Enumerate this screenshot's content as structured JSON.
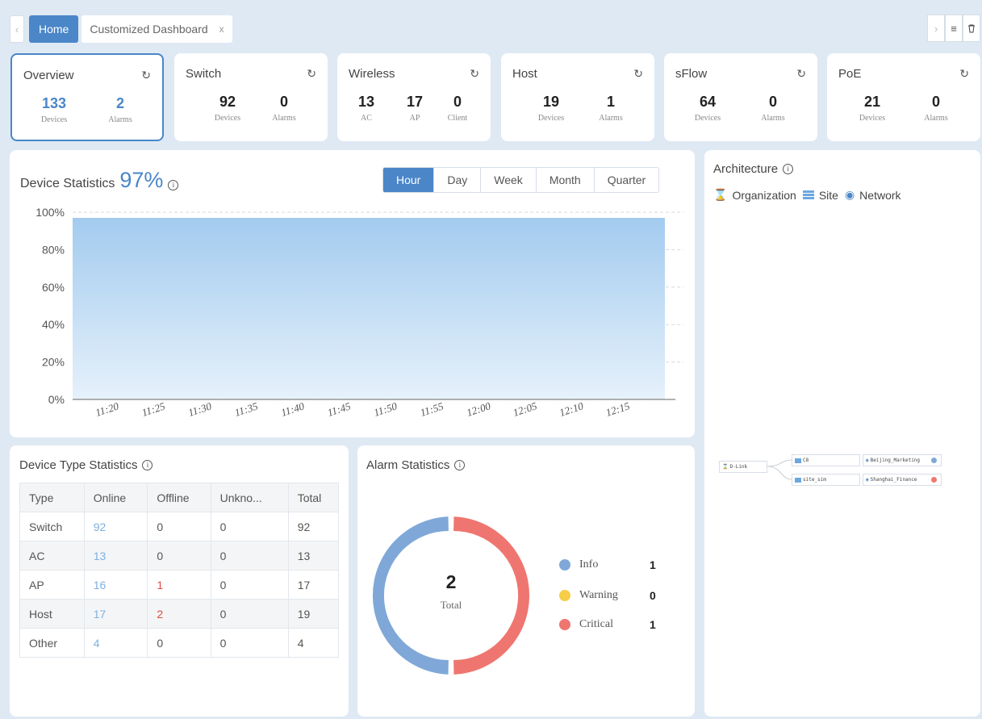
{
  "tabs": {
    "home": "Home",
    "custom": "Customized Dashboard",
    "close": "x"
  },
  "cards": {
    "overview": {
      "title": "Overview",
      "m1": {
        "num": "133",
        "lbl": "Devices"
      },
      "m2": {
        "num": "2",
        "lbl": "Alarms"
      }
    },
    "switch": {
      "title": "Switch",
      "m1": {
        "num": "92",
        "lbl": "Devices"
      },
      "m2": {
        "num": "0",
        "lbl": "Alarms"
      }
    },
    "wireless": {
      "title": "Wireless",
      "m1": {
        "num": "13",
        "lbl": "AC"
      },
      "m2": {
        "num": "17",
        "lbl": "AP"
      },
      "m3": {
        "num": "0",
        "lbl": "Client"
      }
    },
    "host": {
      "title": "Host",
      "m1": {
        "num": "19",
        "lbl": "Devices"
      },
      "m2": {
        "num": "1",
        "lbl": "Alarms"
      }
    },
    "sflow": {
      "title": "sFlow",
      "m1": {
        "num": "64",
        "lbl": "Devices"
      },
      "m2": {
        "num": "0",
        "lbl": "Alarms"
      }
    },
    "poe": {
      "title": "PoE",
      "m1": {
        "num": "21",
        "lbl": "Devices"
      },
      "m2": {
        "num": "0",
        "lbl": "Alarms"
      }
    }
  },
  "device_stats": {
    "title": "Device Statistics",
    "percent": "97%",
    "ranges": [
      "Hour",
      "Day",
      "Week",
      "Month",
      "Quarter"
    ],
    "active_range": "Hour"
  },
  "chart_data": {
    "type": "area",
    "x": [
      "11:20",
      "11:25",
      "11:30",
      "11:35",
      "11:40",
      "11:45",
      "11:50",
      "11:55",
      "12:00",
      "12:05",
      "12:10",
      "12:15"
    ],
    "y_ticks": [
      "100%",
      "80%",
      "60%",
      "40%",
      "20%",
      "0%"
    ],
    "ylim": [
      0,
      100
    ],
    "values": [
      97,
      97,
      97,
      97,
      97,
      97,
      97,
      97,
      97,
      97,
      97,
      97
    ],
    "color": "#a8cef0",
    "grid": true
  },
  "device_type": {
    "title": "Device Type Statistics",
    "headers": [
      "Type",
      "Online",
      "Offline",
      "Unkno...",
      "Total"
    ],
    "rows": [
      [
        "Switch",
        "92",
        "0",
        "0",
        "92"
      ],
      [
        "AC",
        "13",
        "0",
        "0",
        "13"
      ],
      [
        "AP",
        "16",
        "1",
        "0",
        "17"
      ],
      [
        "Host",
        "17",
        "2",
        "0",
        "19"
      ],
      [
        "Other",
        "4",
        "0",
        "0",
        "4"
      ]
    ]
  },
  "alarm_stats": {
    "title": "Alarm Statistics",
    "total": "2",
    "total_label": "Total",
    "legend": [
      {
        "label": "Info",
        "value": "1",
        "color": "#7fa8d8"
      },
      {
        "label": "Warning",
        "value": "0",
        "color": "#f5cd47"
      },
      {
        "label": "Critical",
        "value": "1",
        "color": "#ef7670"
      }
    ]
  },
  "architecture": {
    "title": "Architecture",
    "legend": [
      "Organization",
      "Site",
      "Network"
    ],
    "root": "D-Link",
    "sites": [
      "C8",
      "site_sim"
    ],
    "networks": [
      "Beijing_Marketing",
      "Shanghai_Finance"
    ]
  }
}
